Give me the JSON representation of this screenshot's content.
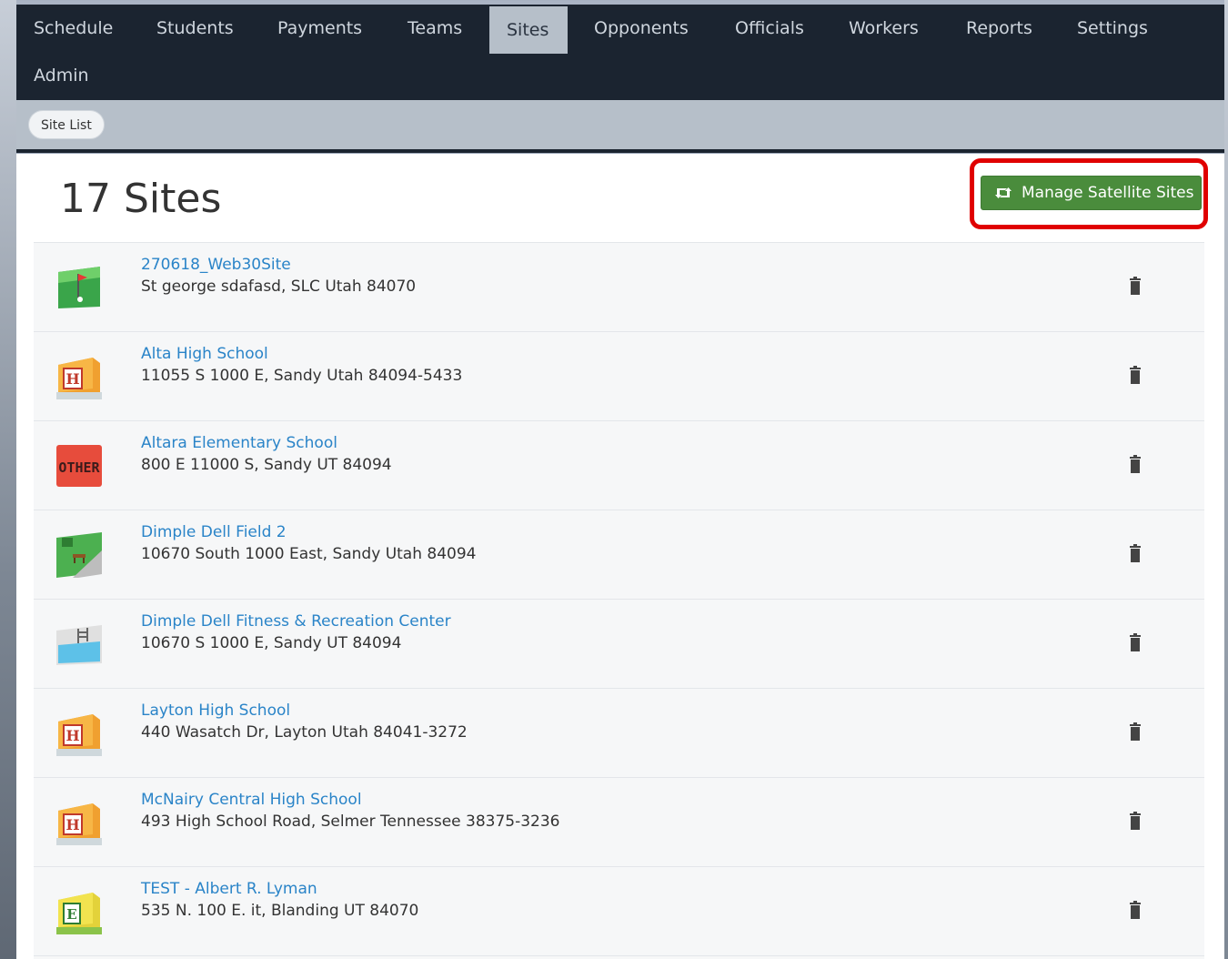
{
  "nav": {
    "items": [
      {
        "label": "Schedule"
      },
      {
        "label": "Students"
      },
      {
        "label": "Payments"
      },
      {
        "label": "Teams"
      },
      {
        "label": "Sites",
        "active": true
      },
      {
        "label": "Opponents"
      },
      {
        "label": "Officials"
      },
      {
        "label": "Workers"
      },
      {
        "label": "Reports"
      },
      {
        "label": "Settings"
      },
      {
        "label": "Admin"
      }
    ]
  },
  "subnav": {
    "site_list": "Site List"
  },
  "page": {
    "title": "17 Sites",
    "manage_button": "Manage Satellite Sites"
  },
  "sites": [
    {
      "name": "270618_Web30Site",
      "address": "St george sdafasd, SLC Utah  84070",
      "icon": "golf-icon"
    },
    {
      "name": "Alta High School",
      "address": "11055 S 1000 E, Sandy Utah  84094-5433",
      "icon": "high-school-icon"
    },
    {
      "name": "Altara Elementary School",
      "address": "800 E 11000 S, Sandy UT  84094",
      "icon": "other-icon",
      "icon_text": "OTHER"
    },
    {
      "name": "Dimple Dell Field 2",
      "address": "10670 South 1000 East, Sandy Utah  84094",
      "icon": "park-icon"
    },
    {
      "name": "Dimple Dell Fitness & Recreation Center",
      "address": "10670 S 1000 E, Sandy UT  84094",
      "icon": "pool-icon"
    },
    {
      "name": "Layton High School",
      "address": "440 Wasatch Dr, Layton Utah  84041-3272",
      "icon": "high-school-icon"
    },
    {
      "name": "McNairy Central High School",
      "address": "493 High School Road, Selmer Tennessee  38375-3236",
      "icon": "high-school-icon"
    },
    {
      "name": "TEST - Albert R. Lyman",
      "address": "535 N. 100 E. it, Blanding UT  84070",
      "icon": "elementary-school-icon"
    }
  ],
  "colors": {
    "nav_bg": "#1b2430",
    "accent_green": "#4a8c3c",
    "link_blue": "#2a84c8",
    "highlight_red": "#e00000"
  }
}
